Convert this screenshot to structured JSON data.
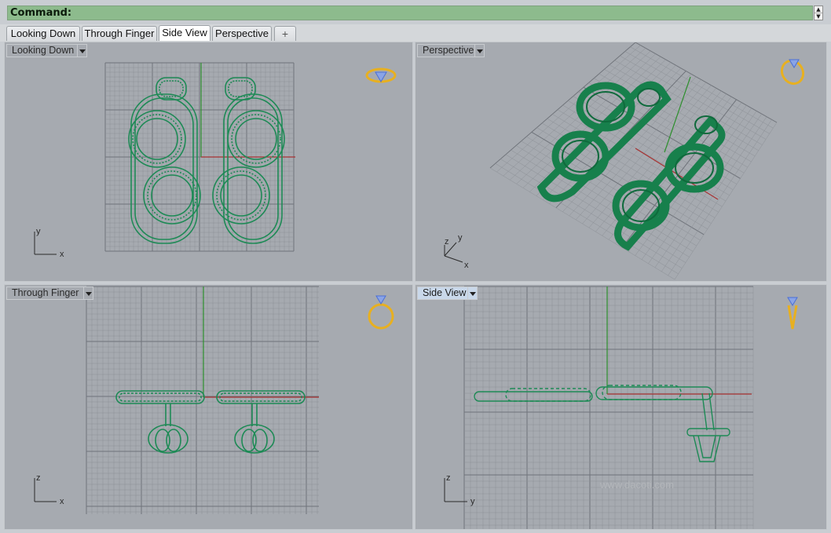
{
  "command": {
    "label": "Command:",
    "spin_up": "▲",
    "spin_down": "▼"
  },
  "tabs": [
    {
      "label": "Looking Down",
      "active": false
    },
    {
      "label": "Through Finger",
      "active": false
    },
    {
      "label": "Side View",
      "active": true
    },
    {
      "label": "Perspective",
      "active": false
    },
    {
      "label": "+",
      "icon": "add-tab-icon"
    }
  ],
  "viewports": {
    "looking_down": {
      "title": "Looking Down",
      "axis_v": "y",
      "axis_h": "x",
      "icon": "ring-top-view-icon"
    },
    "perspective": {
      "title": "Perspective",
      "axis_v": "y",
      "axis_z": "z",
      "axis_h": "x",
      "icon": "ring-perspective-icon"
    },
    "through_finger": {
      "title": "Through Finger",
      "axis_v": "z",
      "axis_h": "x",
      "icon": "ring-front-view-icon"
    },
    "side_view": {
      "title": "Side View",
      "axis_v": "z",
      "axis_h": "y",
      "icon": "ring-side-view-icon",
      "active": true
    }
  },
  "watermark": "www.dacoti.com",
  "colors": {
    "wire": "#1d8a55",
    "grid_minor": "#8c9096",
    "grid_major": "#6f737a",
    "axis_x": "#a83232",
    "axis_y": "#2d8f2d",
    "icon_gold": "#e8b020",
    "icon_blue": "#4a6fd8",
    "command_bg": "#8dbb8d"
  }
}
